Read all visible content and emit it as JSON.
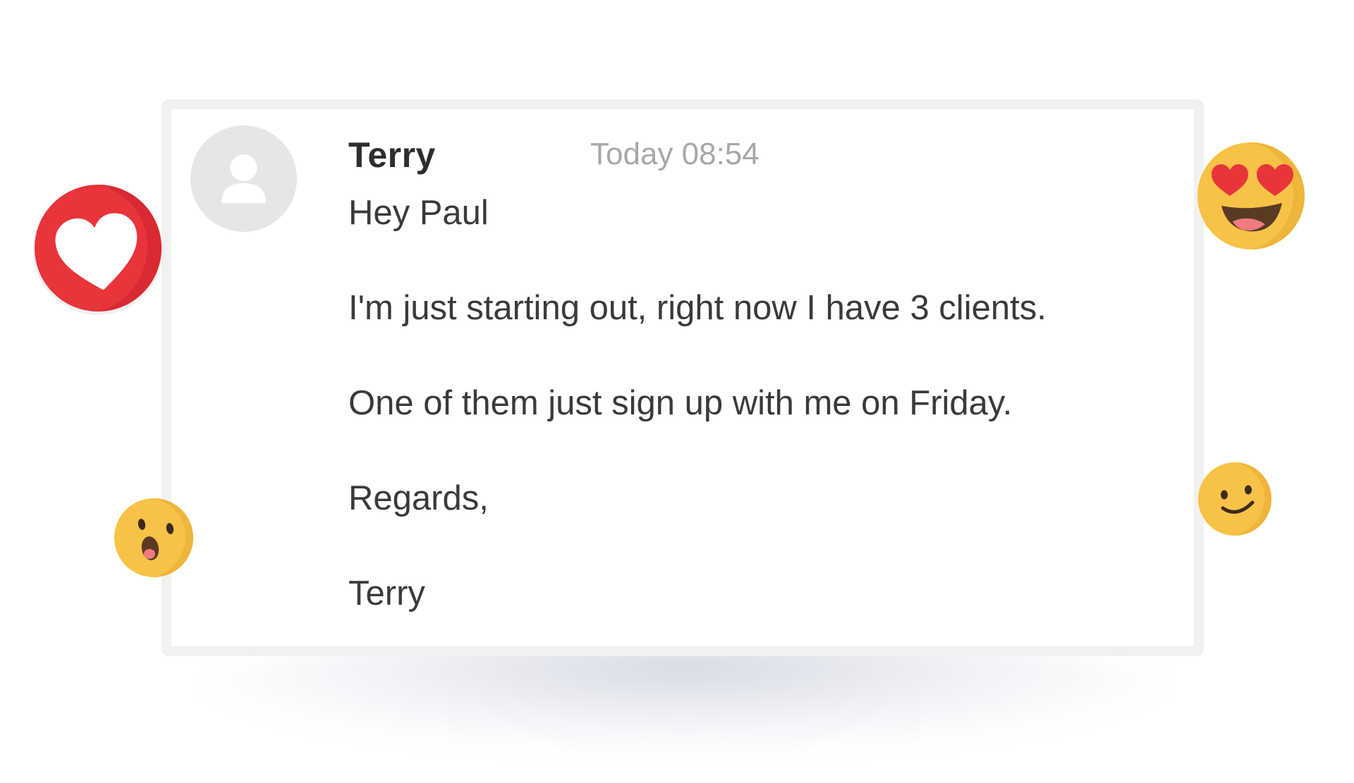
{
  "message": {
    "sender": "Terry",
    "timestamp": "Today 08:54",
    "lines": [
      "Hey Paul",
      "I'm just starting out, right now I have 3 clients.",
      "One of them just sign up with me on Friday.",
      "Regards,",
      "Terry"
    ]
  },
  "avatar": {
    "icon": "user-silhouette-icon"
  },
  "reactions": [
    {
      "icon": "heart-icon",
      "color": "#e8343a"
    },
    {
      "icon": "heart-eyes-emoji-icon",
      "color": "#f7c245"
    },
    {
      "icon": "surprised-emoji-icon",
      "color": "#f7c245"
    },
    {
      "icon": "wink-smile-emoji-icon",
      "color": "#f7c245"
    }
  ]
}
